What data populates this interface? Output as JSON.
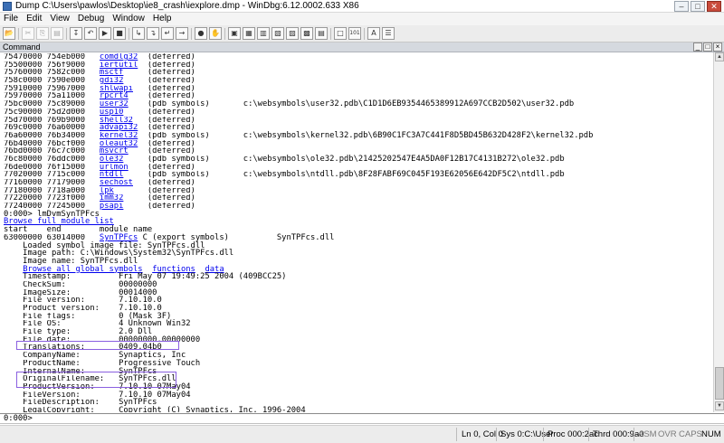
{
  "window": {
    "title": "Dump C:\\Users\\pawlos\\Desktop\\ie8_crash\\iexplore.dmp - WinDbg:6.12.0002.633 X86",
    "min": "–",
    "max": "□",
    "close": "✕"
  },
  "menu": [
    "File",
    "Edit",
    "View",
    "Debug",
    "Window",
    "Help"
  ],
  "toolbar": {
    "open": "📂",
    "cut": "✂",
    "copy": "⎘",
    "paste": "▤",
    "b1": "↧",
    "b2": "↶",
    "b3": "▶",
    "b4": "■",
    "b5": "↳",
    "b6": "↴",
    "b7": "↵",
    "b8": "→",
    "b9": "●",
    "b10": "✋",
    "w1": "▣",
    "w2": "▦",
    "w3": "▥",
    "w4": "▧",
    "w5": "▨",
    "w6": "▩",
    "w7": "▤",
    "src": "□",
    "hex": "101",
    "font": "A",
    "opt": "☰"
  },
  "command_window": {
    "label": "Command",
    "min": "_",
    "max": "□",
    "close": "×"
  },
  "modules": [
    {
      "start": "75470000",
      "end": "754eb000",
      "name": "comdlg32",
      "status": "(deferred)",
      "path": ""
    },
    {
      "start": "75500000",
      "end": "756f9000",
      "name": "iertutil",
      "status": "(deferred)",
      "path": ""
    },
    {
      "start": "75760000",
      "end": "7582c000",
      "name": "msctf",
      "status": "(deferred)",
      "path": ""
    },
    {
      "start": "758c0000",
      "end": "7590e000",
      "name": "gdi32",
      "status": "(deferred)",
      "path": ""
    },
    {
      "start": "75910000",
      "end": "75967000",
      "name": "shlwapi",
      "status": "(deferred)",
      "path": ""
    },
    {
      "start": "75970000",
      "end": "75a11000",
      "name": "rpcrt4",
      "status": "(deferred)",
      "path": ""
    },
    {
      "start": "75bc0000",
      "end": "75c89000",
      "name": "user32",
      "status": "(pdb symbols)",
      "path": "c:\\websymbols\\user32.pdb\\C1D1D6EB9354465389912A697CCB2D502\\user32.pdb"
    },
    {
      "start": "75c90000",
      "end": "75d2d000",
      "name": "usp10",
      "status": "(deferred)",
      "path": ""
    },
    {
      "start": "75d70000",
      "end": "769b9000",
      "name": "shell32",
      "status": "(deferred)",
      "path": ""
    },
    {
      "start": "769c0000",
      "end": "76a60000",
      "name": "advapi32",
      "status": "(deferred)",
      "path": ""
    },
    {
      "start": "76a60000",
      "end": "76b34000",
      "name": "kernel32",
      "status": "(pdb symbols)",
      "path": "c:\\websymbols\\kernel32.pdb\\6B90C1FC3A7C441F8D5BD45B632D428F2\\kernel32.pdb"
    },
    {
      "start": "76b40000",
      "end": "76bcf000",
      "name": "oleaut32",
      "status": "(deferred)",
      "path": ""
    },
    {
      "start": "76bd0000",
      "end": "76c7c000",
      "name": "msvcrt",
      "status": "(deferred)",
      "path": ""
    },
    {
      "start": "76c80000",
      "end": "76ddc000",
      "name": "ole32",
      "status": "(pdb symbols)",
      "path": "c:\\websymbols\\ole32.pdb\\21425202547E4A5DA0F12B17C4131B272\\ole32.pdb"
    },
    {
      "start": "76de0000",
      "end": "76f15000",
      "name": "urlmon",
      "status": "(deferred)",
      "path": ""
    },
    {
      "start": "77020000",
      "end": "7715c000",
      "name": "ntdll",
      "status": "(pdb symbols)",
      "path": "c:\\websymbols\\ntdll.pdb\\8F28FABF69C045F193E62056E642DF5C2\\ntdll.pdb"
    },
    {
      "start": "77160000",
      "end": "77179000",
      "name": "sechost",
      "status": "(deferred)",
      "path": ""
    },
    {
      "start": "77180000",
      "end": "7718a000",
      "name": "lpk",
      "status": "(deferred)",
      "path": ""
    },
    {
      "start": "77220000",
      "end": "7723f000",
      "name": "imm32",
      "status": "(deferred)",
      "path": ""
    },
    {
      "start": "77240000",
      "end": "77245000",
      "name": "psapi",
      "status": "(deferred)",
      "path": ""
    }
  ],
  "cmd": {
    "prompt_line": "0:000> lmDvmSynTPFcs",
    "browse_full": "Browse full module list",
    "header": "start    end        module name",
    "mod_start": "63000000",
    "mod_end": "63014000",
    "mod_name": "SynTPFcs",
    "mod_status": "C (export symbols)",
    "mod_file": "SynTPFcs.dll",
    "loaded_image": "    Loaded symbol image file: SynTPFcs.dll",
    "image_path": "    Image path: C:\\Windows\\System32\\SynTPFcs.dll",
    "image_name": "    Image name: SynTPFcs.dll",
    "browse_all": "Browse all global symbols",
    "functions": "functions",
    "data": "data"
  },
  "props": [
    {
      "k": "Timestamp:",
      "v": "Fri May 07 19:49:25 2004 (409BCC25)"
    },
    {
      "k": "CheckSum:",
      "v": "00000000"
    },
    {
      "k": "ImageSize:",
      "v": "00014000"
    },
    {
      "k": "File version:",
      "v": "7.10.10.0"
    },
    {
      "k": "Product version:",
      "v": "7.10.10.0"
    },
    {
      "k": "File flags:",
      "v": "0 (Mask 3F)"
    },
    {
      "k": "File OS:",
      "v": "4 Unknown Win32"
    },
    {
      "k": "File type:",
      "v": "2.0 Dll"
    },
    {
      "k": "File date:",
      "v": "00000000.00000000"
    },
    {
      "k": "Translations:",
      "v": "0409.04b0"
    },
    {
      "k": "CompanyName:",
      "v": "Synaptics, Inc"
    },
    {
      "k": "ProductName:",
      "v": "Progressive Touch"
    },
    {
      "k": "InternalName:",
      "v": "SynTPFcs"
    },
    {
      "k": "OriginalFilename:",
      "v": "SynTPFcs.dll"
    },
    {
      "k": "ProductVersion:",
      "v": "7.10.10 07May04"
    },
    {
      "k": "FileVersion:",
      "v": "7.10.10 07May04"
    },
    {
      "k": "FileDescription:",
      "v": "SynTPFcs"
    },
    {
      "k": "LegalCopyright:",
      "v": "Copyright (C) Synaptics, Inc. 1996-2004"
    }
  ],
  "input": {
    "prompt": "0:000>",
    "value": ""
  },
  "status": {
    "ln": "Ln 0, Col 0",
    "sys": "Sys 0:C:\\User",
    "proc": "Proc 000:2ac",
    "thrd": "Thrd 000:9a0",
    "asm": "ASM",
    "ovr": "OVR",
    "caps": "CAPS",
    "num": "NUM"
  }
}
